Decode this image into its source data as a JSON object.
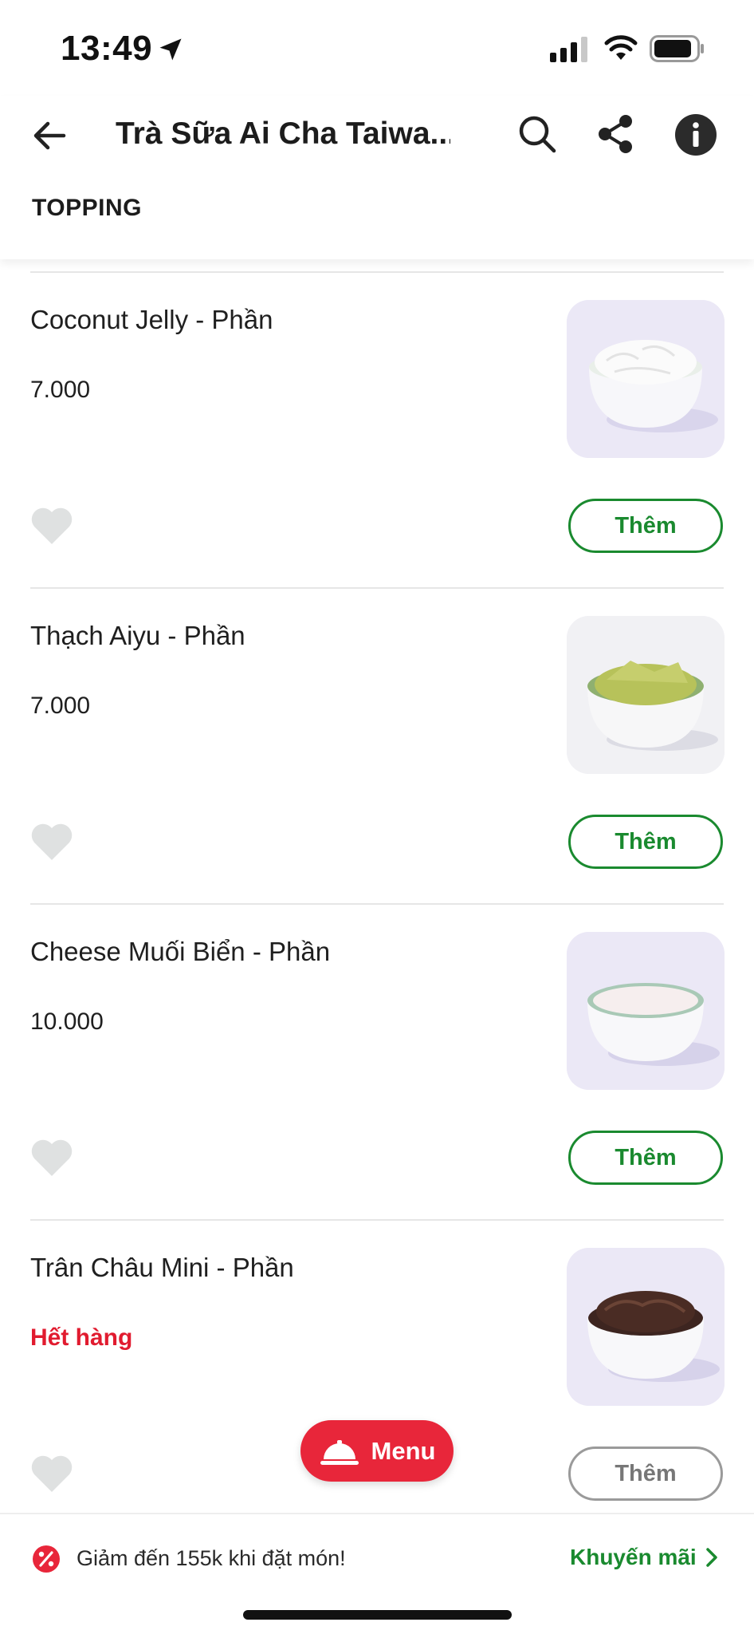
{
  "status_bar": {
    "time": "13:49"
  },
  "header": {
    "title": "Trà Sữa Ai Cha Taiwa...",
    "section": "TOPPING"
  },
  "items": [
    {
      "name": "Coconut Jelly - Phần",
      "price": "7.000",
      "add_label": "Thêm",
      "available": true,
      "image": "coconut-jelly"
    },
    {
      "name": "Thạch Aiyu - Phần",
      "price": "7.000",
      "add_label": "Thêm",
      "available": true,
      "image": "aiyu-jelly"
    },
    {
      "name": "Cheese Muối Biển - Phần",
      "price": "10.000",
      "add_label": "Thêm",
      "available": true,
      "image": "sea-salt-cheese"
    },
    {
      "name": "Trân Châu Mini - Phần",
      "price": "Hết hàng",
      "add_label": "Thêm",
      "available": false,
      "image": "mini-pearls"
    }
  ],
  "menu_button": {
    "label": "Menu"
  },
  "promo": {
    "text": "Giảm đến 155k khi đặt món!",
    "link_label": "Khuyến mãi"
  },
  "colors": {
    "accent_green": "#1a8a2f",
    "accent_red": "#e8263a",
    "soldout_red": "#e11b2f"
  }
}
